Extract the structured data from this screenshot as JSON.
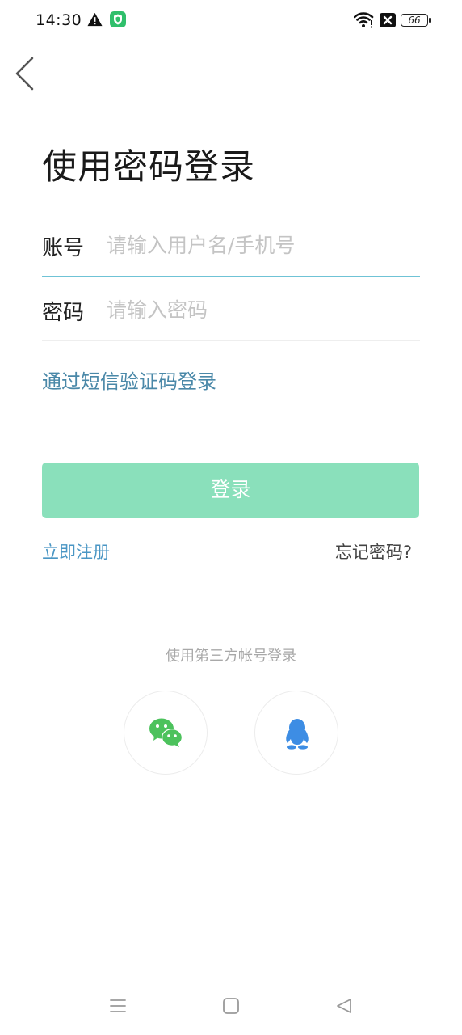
{
  "status_bar": {
    "time": "14:30",
    "battery_level": "66",
    "icons": [
      "warning-icon",
      "shield-icon",
      "wifi-icon",
      "close-box-icon",
      "battery-icon"
    ]
  },
  "header": {
    "back_icon": "chevron-left-icon",
    "title": "使用密码登录"
  },
  "form": {
    "account": {
      "label": "账号",
      "value": "",
      "placeholder": "请输入用户名/手机号"
    },
    "password": {
      "label": "密码",
      "value": "",
      "placeholder": "请输入密码"
    },
    "sms_login_link": "通过短信验证码登录",
    "login_button": "登录",
    "register_link": "立即注册",
    "forgot_password_link": "忘记密码?"
  },
  "third_party": {
    "label": "使用第三方帐号登录",
    "providers": [
      {
        "name": "wechat",
        "icon": "wechat-icon",
        "color": "#4cc25c"
      },
      {
        "name": "qq",
        "icon": "qq-penguin-icon",
        "color": "#3d8de4"
      }
    ]
  },
  "colors": {
    "accent_teal_line": "#6fc3d6",
    "link_blue": "#4a88a8",
    "button_green": "#8ae0bb",
    "placeholder_gray": "#c4c4c4"
  },
  "navigation_bar": {
    "icons": [
      "menu-icon",
      "home-square-icon",
      "back-triangle-icon"
    ]
  }
}
